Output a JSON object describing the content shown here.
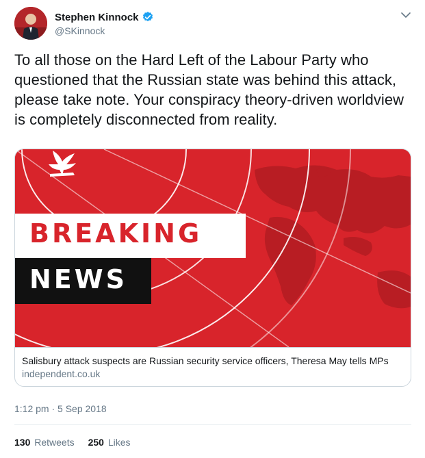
{
  "author": {
    "name": "Stephen Kinnock",
    "handle": "@SKinnock",
    "verified": true
  },
  "tweet": {
    "text": "To all those on the Hard Left of the Labour Party who questioned that the Russian state was behind this attack, please take note. Your conspiracy theory-driven worldview is completely disconnected from reality.",
    "timestamp": "1:12 pm · 5 Sep 2018"
  },
  "card": {
    "image_lines": [
      "BREAKING",
      "NEWS"
    ],
    "title": "Salisbury attack suspects are Russian security service officers, Theresa May tells MPs",
    "domain": "independent.co.uk"
  },
  "stats": {
    "retweets_count": "130",
    "retweets_label": "Retweets",
    "likes_count": "250",
    "likes_label": "Likes"
  },
  "colors": {
    "brand_red": "#d8242b",
    "verified_blue": "#1da1f2",
    "secondary_text": "#657786"
  },
  "icons": [
    "verified-badge-icon",
    "chevron-down-icon",
    "eagle-logo-icon"
  ]
}
